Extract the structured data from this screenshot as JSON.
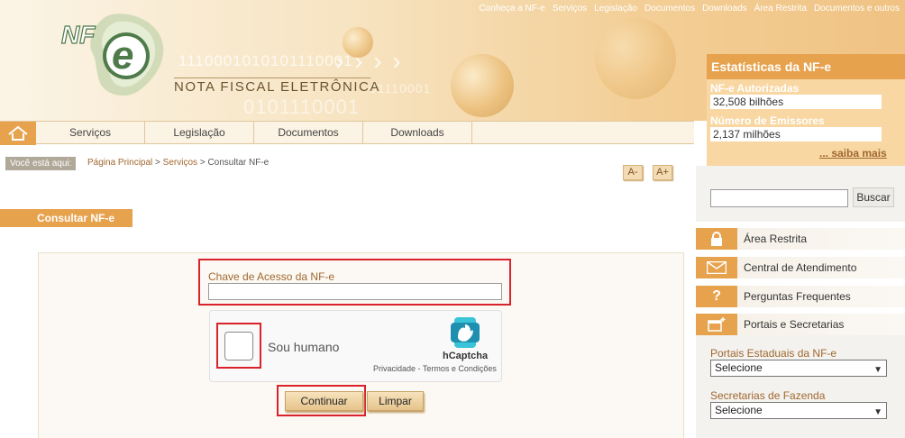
{
  "top_links": [
    "Conheça a NF-e",
    "Serviços",
    "Legislação",
    "Documentos",
    "Downloads",
    "Área Restrita",
    "Documentos e outros"
  ],
  "brand": {
    "logo_text": "NF",
    "logo_letter": "e",
    "title": "NOTA FISCAL ELETRÔNICA",
    "binary_1": "1110001010101110001",
    "binary_2": "01110001",
    "binary_3": "0101110001"
  },
  "nav": {
    "items": [
      "Serviços",
      "Legislação",
      "Documentos",
      "Downloads"
    ]
  },
  "breadcrumb": {
    "label": "Você está aqui:",
    "items": [
      "Página Principal",
      "Serviços",
      "Consultar NF-e"
    ]
  },
  "font_size": {
    "decrease": "A-",
    "increase": "A+"
  },
  "section_title": "Consultar NF-e",
  "form": {
    "chave_label": "Chave de Acesso da NF-e",
    "chave_value": ""
  },
  "captcha": {
    "text": "Sou humano",
    "brand": "hCaptcha",
    "privacy": "Privacidade",
    "separator": " - ",
    "terms": "Termos e Condições"
  },
  "buttons": {
    "continuar": "Continuar",
    "limpar": "Limpar"
  },
  "stats": {
    "title": "Estatísticas da NF-e",
    "autorizadas_label": "NF-e Autorizadas",
    "autorizadas_value": "32,508 bilhões",
    "emissores_label": "Número de Emissores",
    "emissores_value": "2,137 milhões",
    "saiba_mais": "... saiba mais"
  },
  "search": {
    "value": "",
    "button": "Buscar"
  },
  "side_menu": [
    {
      "label": "Área Restrita",
      "icon": "lock-icon"
    },
    {
      "label": "Central de Atendimento",
      "icon": "envelope-icon"
    },
    {
      "label": "Perguntas Frequentes",
      "icon": "question-icon"
    },
    {
      "label": "Portais e Secretarias",
      "icon": "window-add-icon"
    }
  ],
  "portals": {
    "estaduais_label": "Portais Estaduais da NF-e",
    "estaduais_selected": "Selecione",
    "secretarias_label": "Secretarias de Fazenda",
    "secretarias_selected": "Selecione"
  },
  "colors": {
    "accent": "#e7a24e",
    "highlight": "#d9222a",
    "link": "#a0672e"
  }
}
